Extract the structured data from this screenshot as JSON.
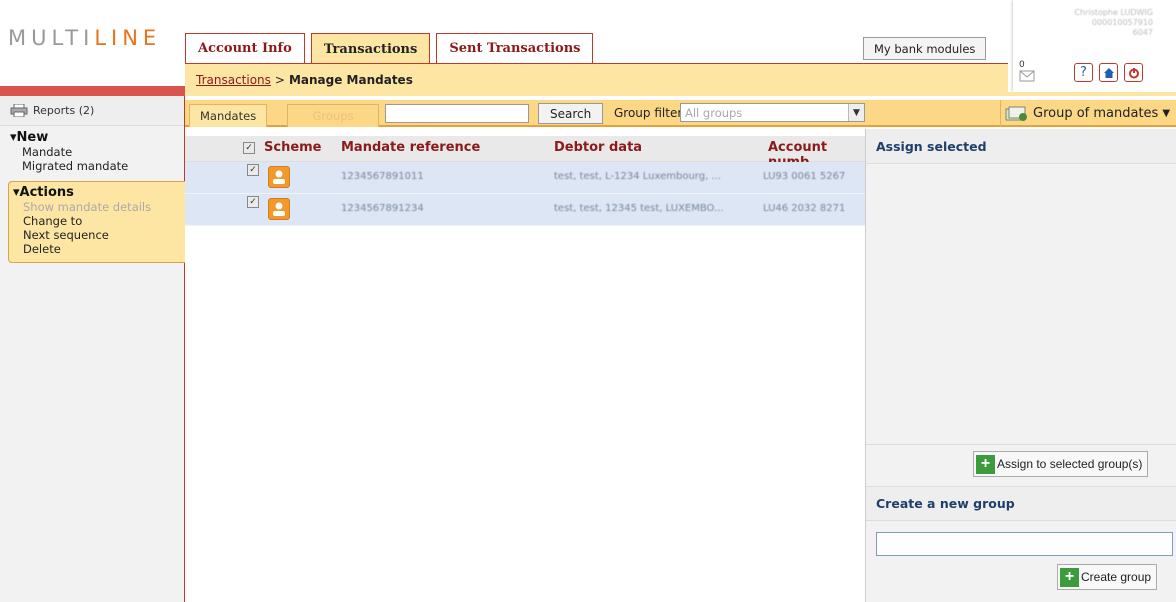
{
  "logo": {
    "text_a": "MULTI",
    "text_b": "LINE"
  },
  "sidebar": {
    "reports_label": "Reports (2)",
    "new_title": "New",
    "new_items": [
      "Mandate",
      "Migrated mandate"
    ],
    "actions_title": "Actions",
    "action_show": "Show mandate details",
    "action_change": "Change to Next sequence",
    "action_delete": "Delete"
  },
  "tabs": {
    "account": "Account Info",
    "transactions": "Transactions",
    "sent": "Sent Transactions"
  },
  "bank_modules_label": "My bank modules",
  "user": {
    "name": "Christophe LUDWIG",
    "line2": "000010057910",
    "line3": "6047",
    "mail_count": "0"
  },
  "breadcrumb": {
    "link": "Transactions",
    "separator": ">",
    "current": "Manage Mandates"
  },
  "toolbar": {
    "tab_mandates": "Mandates",
    "tab_groups": "Groups",
    "search_value": "",
    "search_button": "Search",
    "group_filter_label": "Group filter",
    "group_filter_value": "All groups",
    "group_of_mandates": "Group of mandates"
  },
  "table": {
    "headers": {
      "scheme": "Scheme",
      "reference": "Mandate reference",
      "debtor": "Debtor data",
      "account": "Account numb"
    },
    "rows": [
      {
        "reference": "1234567891011",
        "debtor": "test, test, L-1234 Luxembourg, ...",
        "account": "LU93 0061 5267"
      },
      {
        "reference": "1234567891234",
        "debtor": "test, test, 12345 test, LUXEMBO...",
        "account": "LU46 2032 8271"
      }
    ]
  },
  "right_panel": {
    "assign_title": "Assign selected",
    "assign_button": "Assign to selected group(s)",
    "create_title": "Create a new group",
    "create_input_value": "",
    "create_button": "Create group"
  },
  "colors": {
    "accent_red": "#c0392b",
    "band_yellow": "#fde6a4",
    "toolbar_orange": "#fcd786",
    "row_blue": "#dce6f5"
  }
}
